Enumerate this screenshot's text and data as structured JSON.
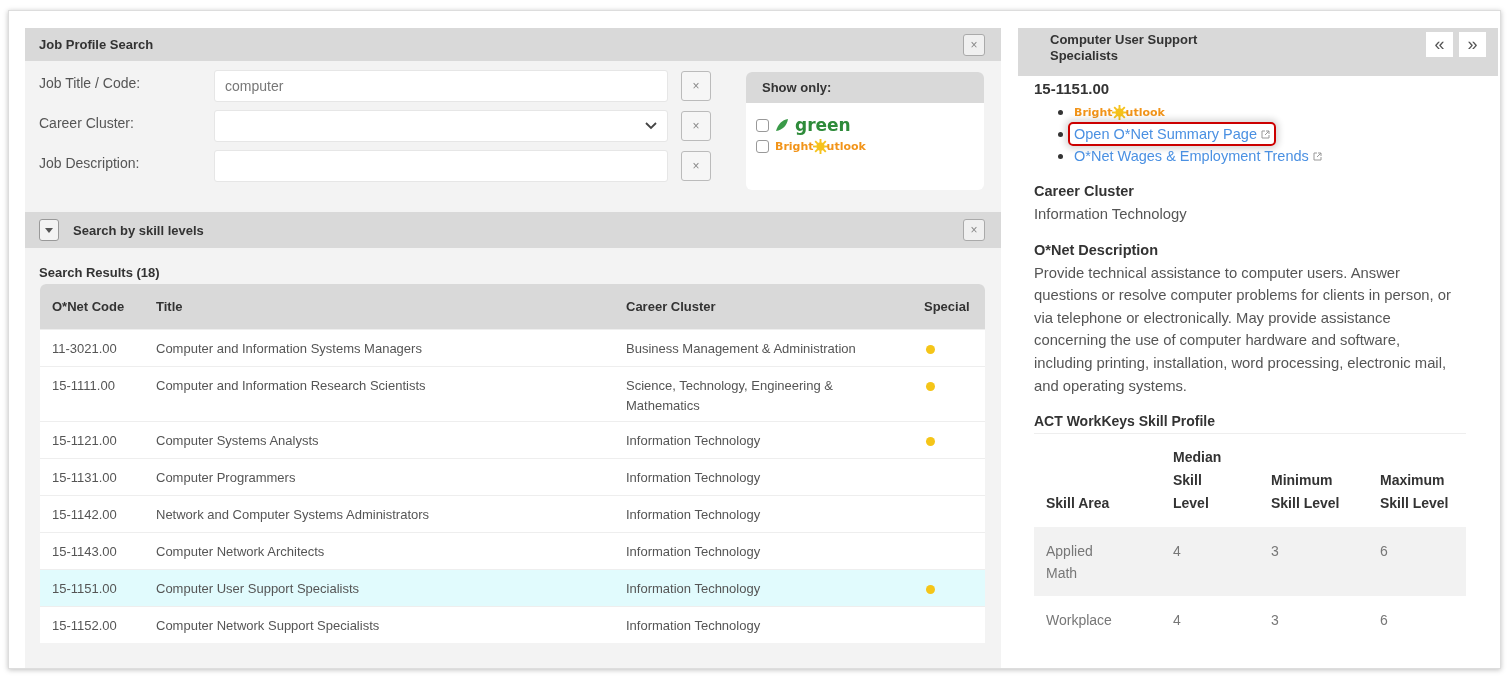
{
  "search_panel": {
    "title": "Job Profile Search",
    "close_label": "×",
    "fields": [
      {
        "kind": "text",
        "label": "Job Title / Code:",
        "value": "computer",
        "clear_label": "×"
      },
      {
        "kind": "select",
        "label": "Career Cluster:",
        "clear_label": "×"
      },
      {
        "kind": "text",
        "label": "Job Description:",
        "clear_label": "×"
      }
    ],
    "show_only": {
      "title": "Show only:",
      "options": [
        {
          "kind": "green",
          "label": "green",
          "checked": false
        },
        {
          "kind": "bright_outlook",
          "label_start": "Bright",
          "label_end": "utlook",
          "checked": false
        }
      ]
    }
  },
  "skill_section": {
    "title": "Search by skill levels",
    "expanded": false,
    "close_label": "×"
  },
  "results": {
    "title": "Search Results (18)",
    "columns": [
      "O*Net Code",
      "Title",
      "Career Cluster",
      "Special"
    ],
    "rows": [
      {
        "code": "11-3021.00",
        "title": "Computer and Information Systems Managers",
        "cluster": "Business Management & Administration",
        "special": true,
        "selected": false
      },
      {
        "code": "15-1111.00",
        "title": "Computer and Information Research Scientists",
        "cluster": "Science, Technology, Engineering & Mathematics",
        "special": true,
        "selected": false
      },
      {
        "code": "15-1121.00",
        "title": "Computer Systems Analysts",
        "cluster": "Information Technology",
        "special": true,
        "selected": false
      },
      {
        "code": "15-1131.00",
        "title": "Computer Programmers",
        "cluster": "Information Technology",
        "special": false,
        "selected": false
      },
      {
        "code": "15-1142.00",
        "title": "Network and Computer Systems Administrators",
        "cluster": "Information Technology",
        "special": false,
        "selected": false
      },
      {
        "code": "15-1143.00",
        "title": "Computer Network Architects",
        "cluster": "Information Technology",
        "special": false,
        "selected": false
      },
      {
        "code": "15-1151.00",
        "title": "Computer User Support Specialists",
        "cluster": "Information Technology",
        "special": true,
        "selected": true
      },
      {
        "code": "15-1152.00",
        "title": "Computer Network Support Specialists",
        "cluster": "Information Technology",
        "special": false,
        "selected": false
      }
    ]
  },
  "detail": {
    "title": "Computer User Support Specialists",
    "prev_label": "«",
    "next_label": "»",
    "code": "15-1151.00",
    "links": [
      {
        "kind": "bright_outlook",
        "label_start": "Bright",
        "label_end": "utlook"
      },
      {
        "kind": "link",
        "label": "Open O*Net Summary Page",
        "highlighted": true
      },
      {
        "kind": "link",
        "label": "O*Net Wages & Employment Trends",
        "highlighted": false
      }
    ],
    "sections": [
      {
        "heading": "Career Cluster",
        "text": "Information Technology"
      },
      {
        "heading": "O*Net Description",
        "text": "Provide technical assistance to computer users. Answer questions or resolve computer problems for clients in person, or via telephone or electronically. May provide assistance concerning the use of computer hardware and software, including printing, installation, word processing, electronic mail, and operating systems."
      }
    ],
    "skill_profile": {
      "title": "ACT WorkKeys Skill Profile",
      "columns": [
        "Skill Area",
        "Median Skill Level",
        "Minimum Skill Level",
        "Maximum Skill Level"
      ],
      "rows": [
        {
          "area": "Applied Math",
          "median": "4",
          "minimum": "3",
          "maximum": "6"
        },
        {
          "area": "Workplace",
          "median": "4",
          "minimum": "3",
          "maximum": "6"
        }
      ]
    }
  }
}
